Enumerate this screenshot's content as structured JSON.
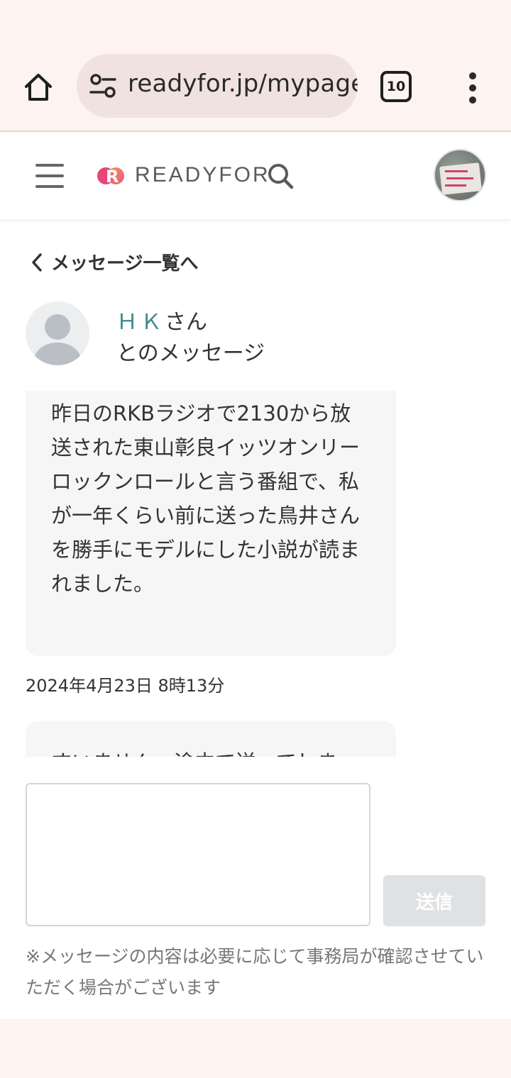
{
  "browser": {
    "url": "readyfor.jp/mypage",
    "tab_count": "10"
  },
  "header": {
    "logo_text": "READYFOR"
  },
  "nav": {
    "back_label": "メッセージ一覧へ"
  },
  "conversation": {
    "partner_name": "ＨＫ",
    "partner_suffix": "さん",
    "subtitle": "とのメッセージ"
  },
  "messages": [
    {
      "text": "昨日のRKBラジオで2130から放送された東山彰良イッツオンリーロックンロールと言う番組で、私が一年くらい前に送った鳥井さんを勝手にモデルにした小説が読まれました。",
      "timestamp": "2024年4月23日 8時13分"
    },
    {
      "text": "すいません、途中で送ってしま"
    }
  ],
  "composer": {
    "value": "",
    "send_label": "送信",
    "notice": "※メッセージの内容は必要に応じて事務局が確認させていただく場合がございます"
  },
  "colors": {
    "brand_teal": "#3e8a8c",
    "logo_pink": "#e8457a",
    "logo_orange": "#f28c3a",
    "send_disabled": "#dfe1e3"
  }
}
